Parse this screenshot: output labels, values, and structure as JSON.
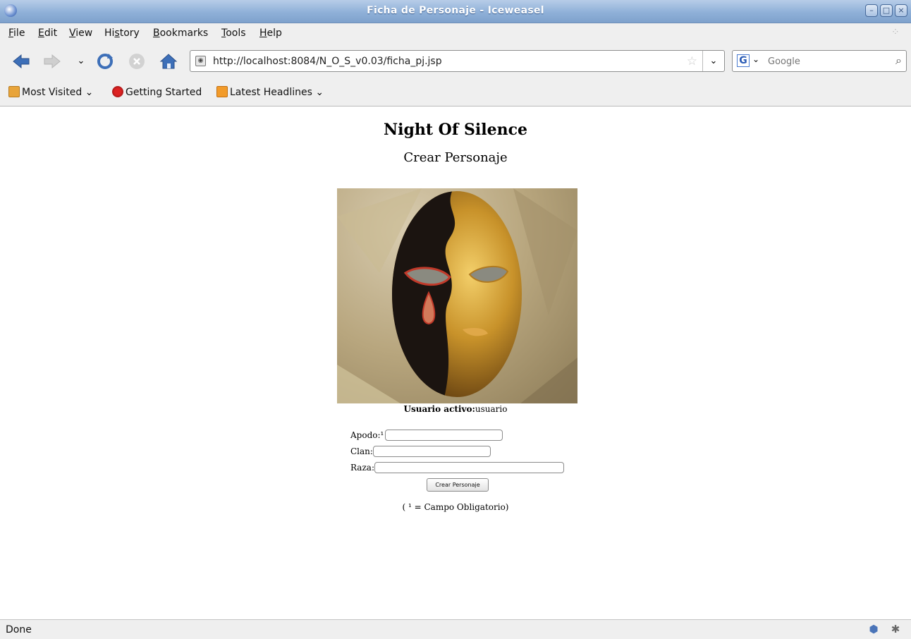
{
  "window": {
    "title": "Ficha de Personaje - Iceweasel"
  },
  "menubar": {
    "items": [
      {
        "pre": "",
        "key": "F",
        "post": "ile"
      },
      {
        "pre": "",
        "key": "E",
        "post": "dit"
      },
      {
        "pre": "",
        "key": "V",
        "post": "iew"
      },
      {
        "pre": "Hi",
        "key": "s",
        "post": "tory"
      },
      {
        "pre": "",
        "key": "B",
        "post": "ookmarks"
      },
      {
        "pre": "",
        "key": "T",
        "post": "ools"
      },
      {
        "pre": "",
        "key": "H",
        "post": "elp"
      }
    ]
  },
  "navbar": {
    "url": "http://localhost:8084/N_O_S_v0.03/ficha_pj.jsp",
    "search_placeholder": "Google",
    "search_engine_letter": "G"
  },
  "bookmarks": {
    "most_visited": "Most Visited",
    "getting_started": "Getting Started",
    "latest_headlines": "Latest Headlines"
  },
  "page": {
    "heading": "Night Of Silence",
    "subheading": "Crear Personaje",
    "active_user_label": "Usuario activo:",
    "active_user_value": "usuario",
    "fields": {
      "apodo_label": "Apodo:",
      "required_mark": "¹",
      "clan_label": "Clan:",
      "raza_label": "Raza:"
    },
    "submit_label": "Crear Personaje",
    "footnote": "( ¹ = Campo Obligatorio)"
  },
  "status": {
    "text": "Done"
  },
  "colors": {
    "titlebar": "#8fb0d8",
    "toolbar": "#efefef",
    "mask_gold": "#c8922a",
    "mask_dark": "#1b1410"
  }
}
